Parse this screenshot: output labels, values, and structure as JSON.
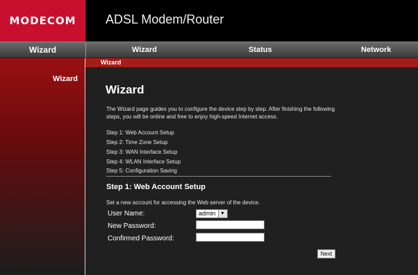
{
  "header": {
    "logo": "MODECOM",
    "product_title": "ADSL Modem/Router"
  },
  "nav": {
    "side_label": "Wizard",
    "items": [
      {
        "label": "Wizard"
      },
      {
        "label": "Status"
      },
      {
        "label": "Network"
      }
    ]
  },
  "sidebar": {
    "items": [
      {
        "label": "Wizard"
      }
    ]
  },
  "content": {
    "breadcrumb": "Wizard",
    "title": "Wizard",
    "intro": "The Wizard page guides you to configure the device step by step. After finishing the following steps, you will be online and free to enjoy high-speed Internet access.",
    "steps": [
      "Step 1: Web Account Setup",
      "Step 2: Time Zone Setup",
      "Step 3: WAN Interface Setup",
      "Step 4: WLAN Interface Setup",
      "Step 5: Configuration Saving"
    ],
    "section_title": "Step 1: Web Account Setup",
    "section_note": "Set a new account for accessing the Web server of the device.",
    "form": {
      "username_label": "User Name:",
      "username_value": "admin",
      "new_password_label": "New Password:",
      "new_password_value": "",
      "confirm_password_label": "Confirmed Password:",
      "confirm_password_value": ""
    },
    "next_label": "Next"
  },
  "colors": {
    "brand_red": "#c8102e",
    "crumb_red": "#a51d18",
    "background": "#1b1b1b"
  }
}
